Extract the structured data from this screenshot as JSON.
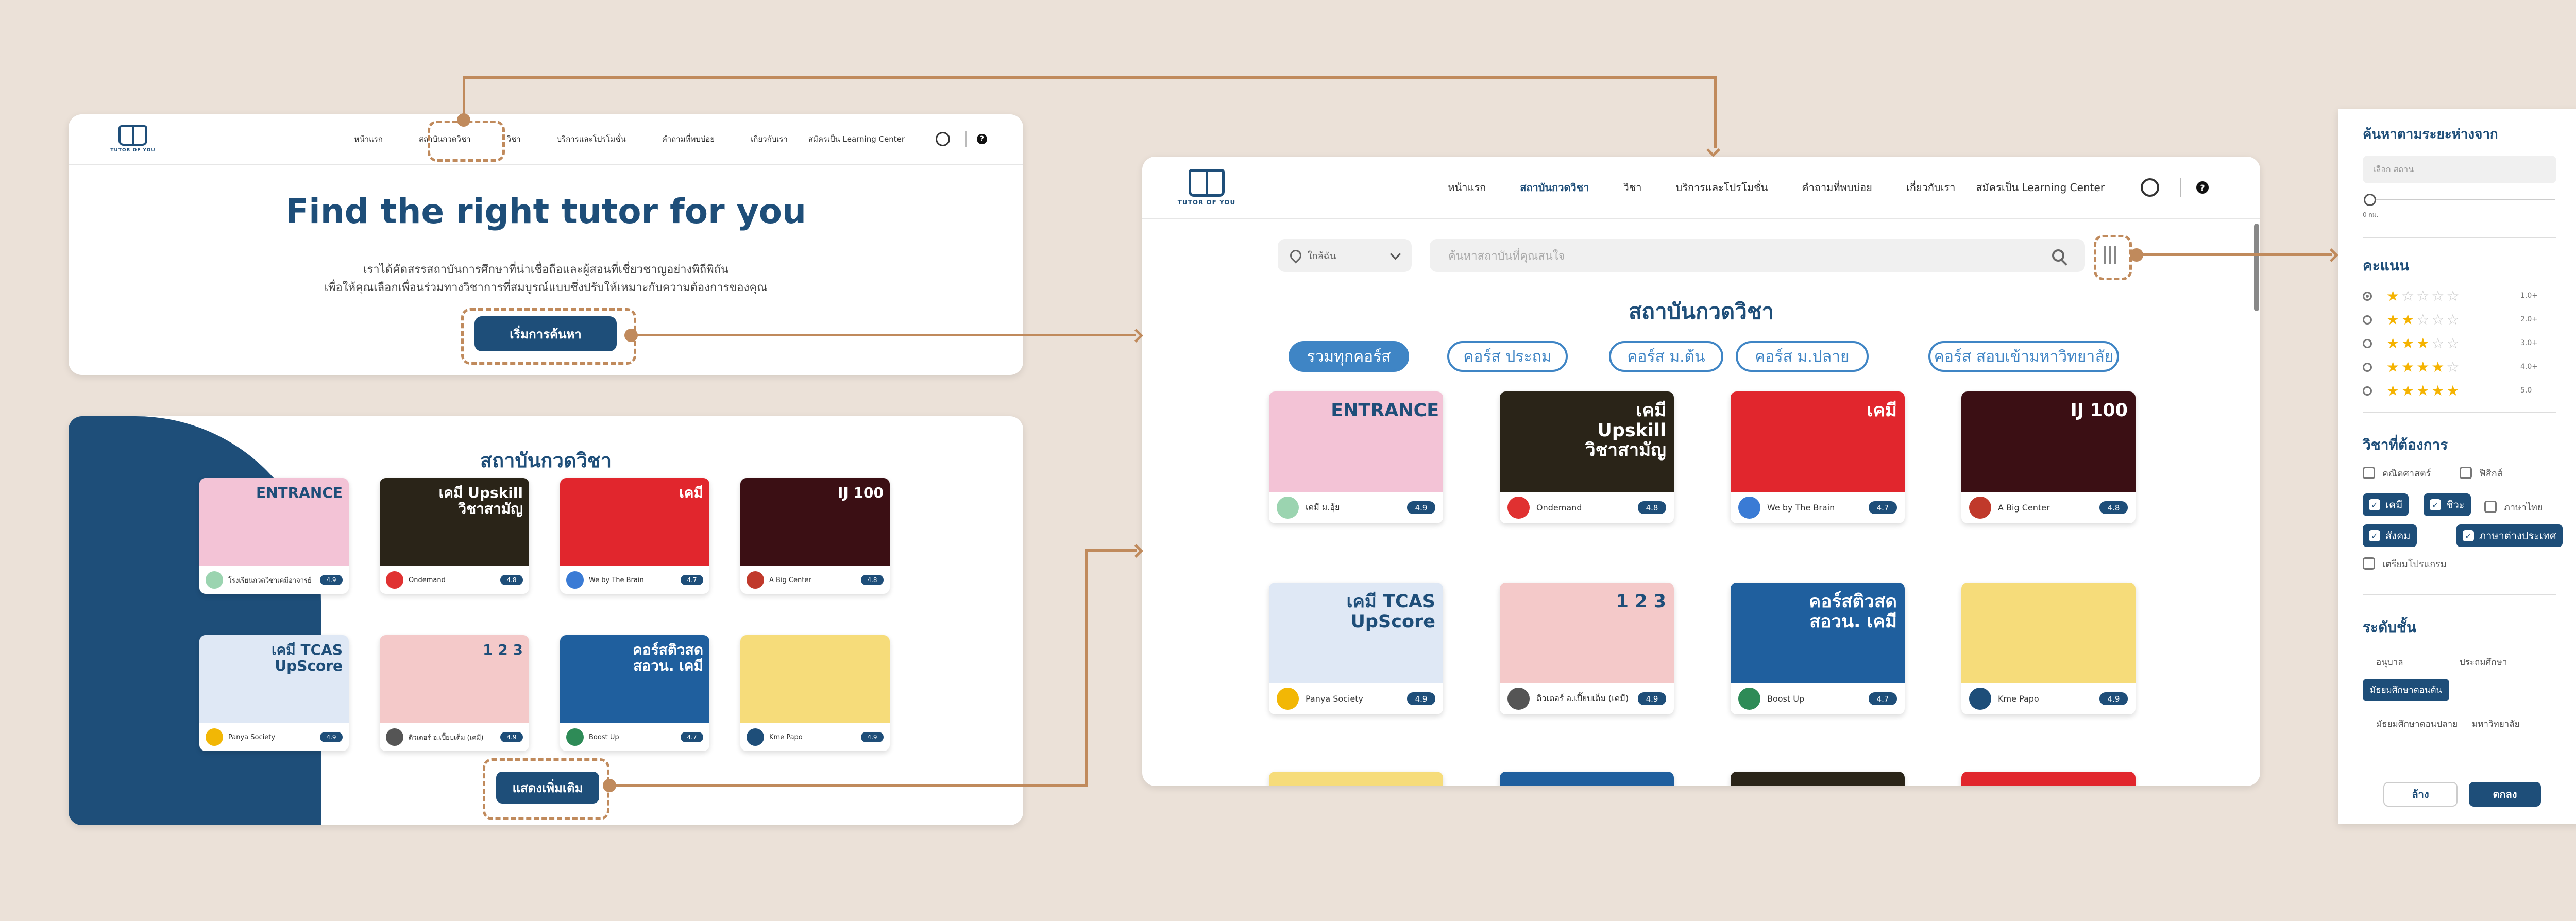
{
  "brand": {
    "name": "TUTOR OF YOU"
  },
  "nav": {
    "items": [
      "หน้าแรก",
      "สถาบันกวดวิชา",
      "วิชา",
      "บริการและโปรโมชั่น",
      "คำถามที่พบบ่อย",
      "เกี่ยวกับเรา",
      "สมัครเป็น Learning Center"
    ]
  },
  "hero": {
    "title": "Find the right tutor for you",
    "line1": "เราได้คัดสรรสถาบันการศึกษาที่น่าเชื่อถือและผู้สอนที่เชี่ยวชาญอย่างพิถีพิถัน",
    "line2": "เพื่อให้คุณเลือกเพื่อนร่วมทางวิชาการที่สมบูรณ์แบบซึ่งปรับให้เหมาะกับความต้องการของคุณ",
    "cta": "เริ่มการค้นหา"
  },
  "institutes": {
    "title": "สถาบันกวดวิชา",
    "more_button": "แสดงเพิ่มเติม",
    "cards": [
      {
        "name": "โรงเรียนกวดวิชาเคมีอาจารย์อ๊อฟ ม.อุ้ย",
        "short": "เคมี ม.อุ้ย",
        "rating": "4.9",
        "thumb_text": "ENTRANCE",
        "bg": "#f3c3d6",
        "logo": "#9bd4b0"
      },
      {
        "name": "Ondemand",
        "short": "Ondemand",
        "rating": "4.8",
        "thumb_text": "เคมี Upskill วิชาสามัญ",
        "bg": "#2a2418",
        "logo": "#e03131"
      },
      {
        "name": "We by The Brain",
        "short": "We by The Brain",
        "rating": "4.7",
        "thumb_text": "เคมี",
        "bg": "#e1262d",
        "logo": "#3a7bd5"
      },
      {
        "name": "A Big Center",
        "short": "A Big Center",
        "rating": "4.8",
        "thumb_text": "IJ 100",
        "bg": "#3b0f14",
        "logo": "#c0392b"
      },
      {
        "name": "Panya Society",
        "short": "Panya Society",
        "rating": "4.9",
        "thumb_text": "เคมี TCAS UpScore",
        "bg": "#dfe8f5",
        "logo": "#f2b705"
      },
      {
        "name": "ติวเตอร์ อ.เปี๊ยบเต็ม (เคมี)",
        "short": "ติวเตอร์ อ.เปี๊ยบเต็ม (เคมี)",
        "rating": "4.9",
        "thumb_text": "1 2 3",
        "bg": "#f4c9c9",
        "logo": "#555555"
      },
      {
        "name": "Boost Up",
        "short": "Boost Up",
        "rating": "4.7",
        "thumb_text": "คอร์สติวสด สอวน. เคมี",
        "bg": "#1f5f9e",
        "logo": "#2e8b57"
      },
      {
        "name": "Kme Papo",
        "short": "Kme Papo",
        "rating": "4.9",
        "thumb_text": "",
        "bg": "#f6dc7a",
        "logo": "#1e4e79"
      }
    ]
  },
  "search_page": {
    "location_placeholder": "ใกล้ฉัน",
    "search_placeholder": "ค้นหาสถาบันที่คุณสนใจ",
    "title": "สถาบันกวดวิชา",
    "tabs": [
      "รวมทุกคอร์ส",
      "คอร์ส ประถม",
      "คอร์ส ม.ต้น",
      "คอร์ส ม.ปลาย",
      "คอร์ส สอบเข้ามหาวิทยาลัย"
    ]
  },
  "filter": {
    "distance_title": "ค้นหาตามระยะห่างจาก",
    "distance_placeholder": "เลือก สถาน",
    "distance_value": "0 กม.",
    "rating_title": "คะแนน",
    "ratings": [
      {
        "stars": 1,
        "label": "1.0+"
      },
      {
        "stars": 2,
        "label": "2.0+"
      },
      {
        "stars": 3,
        "label": "3.0+"
      },
      {
        "stars": 4,
        "label": "4.0+"
      },
      {
        "stars": 5,
        "label": "5.0"
      }
    ],
    "subject_title": "วิชาที่ต้องการ",
    "subjects": [
      {
        "label": "คณิตศาสตร์",
        "checked": false
      },
      {
        "label": "ฟิสิกส์",
        "checked": false
      },
      {
        "label": "เคมี",
        "checked": true
      },
      {
        "label": "ชีวะ",
        "checked": true
      },
      {
        "label": "ภาษาไทย",
        "checked": false
      },
      {
        "label": "สังคม",
        "checked": true
      },
      {
        "label": "ภาษาต่างประเทศ",
        "checked": true
      },
      {
        "label": "เตรียมโปรแกรม",
        "checked": false
      }
    ],
    "level_title": "ระดับชั้น",
    "levels": [
      {
        "label": "อนุบาล",
        "selected": false
      },
      {
        "label": "ประถมศึกษา",
        "selected": false
      },
      {
        "label": "มัธยมศึกษาตอนต้น",
        "selected": true
      },
      {
        "label": "มัธยมศึกษาตอนปลาย",
        "selected": false
      },
      {
        "label": "มหาวิทยาลัย",
        "selected": false
      }
    ],
    "clear": "ล้าง",
    "apply": "ตกลง"
  },
  "colors": {
    "accent": "#1e4e79",
    "connector": "#c08a5c",
    "pill": "#3f85c5",
    "star": "#f5b301"
  }
}
